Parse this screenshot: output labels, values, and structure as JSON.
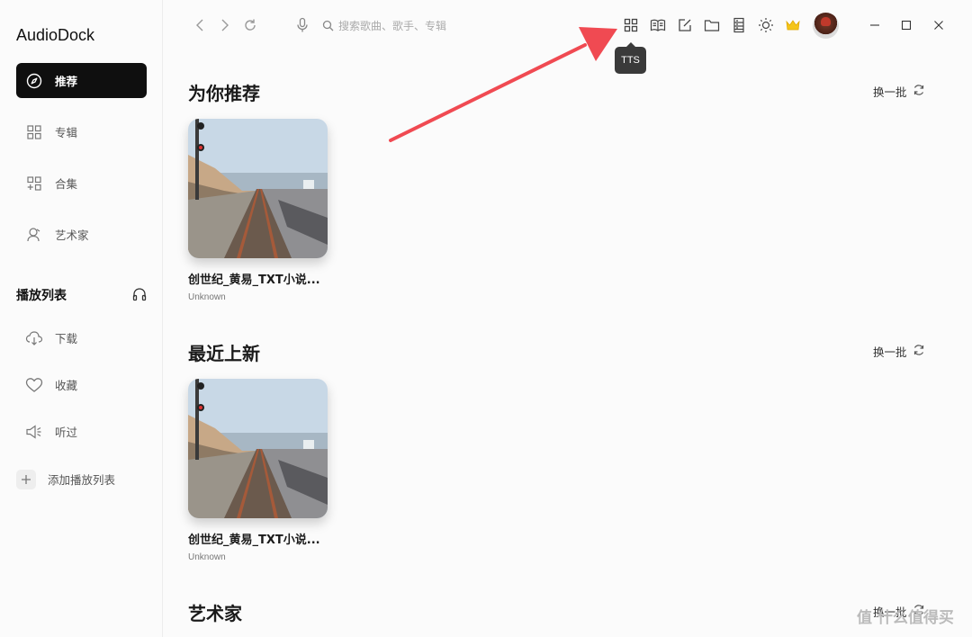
{
  "app": {
    "name": "AudioDock"
  },
  "sidebar": {
    "nav": [
      {
        "label": "推荐",
        "icon": "compass-icon",
        "active": true
      },
      {
        "label": "专辑",
        "icon": "grid-icon"
      },
      {
        "label": "合集",
        "icon": "collection-icon"
      },
      {
        "label": "艺术家",
        "icon": "artist-icon"
      }
    ],
    "playlist_title": "播放列表",
    "playlist_items": [
      {
        "label": "下载",
        "icon": "download-icon"
      },
      {
        "label": "收藏",
        "icon": "heart-icon"
      },
      {
        "label": "听过",
        "icon": "speaker-icon"
      },
      {
        "label": "添加播放列表",
        "icon": "plus-icon"
      }
    ]
  },
  "topbar": {
    "search_placeholder": "搜索歌曲、歌手、专辑",
    "tooltip": "TTS",
    "icons": [
      "back-icon",
      "forward-icon",
      "reload-icon",
      "mic-icon",
      "search-icon",
      "tts-icon",
      "book-icon",
      "edit-icon",
      "folder-icon",
      "list-icon",
      "sun-icon",
      "crown-icon",
      "avatar",
      "minimize-icon",
      "maximize-icon",
      "close-icon"
    ]
  },
  "main": {
    "sections": [
      {
        "title": "为你推荐",
        "refresh_label": "换一批",
        "card": {
          "title": "创世纪_黄易_TXT小说...",
          "sub": "Unknown"
        }
      },
      {
        "title": "最近上新",
        "refresh_label": "换一批",
        "card": {
          "title": "创世纪_黄易_TXT小说...",
          "sub": "Unknown"
        }
      },
      {
        "title": "艺术家",
        "refresh_label": "换一批"
      }
    ]
  },
  "watermark": "值 什么值得买",
  "colors": {
    "active_bg": "#0f0f0f",
    "annotation_arrow": "#f04a52",
    "crown": "#f5c518"
  }
}
